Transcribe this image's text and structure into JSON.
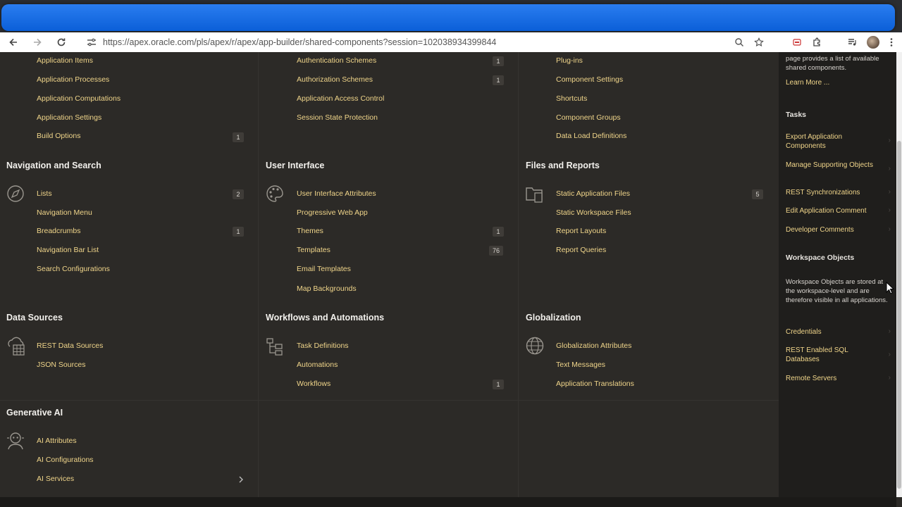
{
  "browser": {
    "url": "https://apex.oracle.com/pls/apex/r/apex/app-builder/shared-components?session=102038934399844"
  },
  "sections": {
    "app_logic": {
      "items": [
        {
          "label": "Application Items",
          "count": ""
        },
        {
          "label": "Application Processes",
          "count": ""
        },
        {
          "label": "Application Computations",
          "count": ""
        },
        {
          "label": "Application Settings",
          "count": ""
        },
        {
          "label": "Build Options",
          "count": "1"
        }
      ]
    },
    "security": {
      "items": [
        {
          "label": "Authentication Schemes",
          "count": "1"
        },
        {
          "label": "Authorization Schemes",
          "count": "1"
        },
        {
          "label": "Application Access Control",
          "count": ""
        },
        {
          "label": "Session State Protection",
          "count": ""
        }
      ]
    },
    "other_components": {
      "items": [
        {
          "label": "Plug-ins",
          "count": ""
        },
        {
          "label": "Component Settings",
          "count": ""
        },
        {
          "label": "Shortcuts",
          "count": ""
        },
        {
          "label": "Component Groups",
          "count": ""
        },
        {
          "label": "Data Load Definitions",
          "count": ""
        }
      ]
    },
    "navigation": {
      "title": "Navigation and Search",
      "icon": "compass-icon",
      "items": [
        {
          "label": "Lists",
          "count": "2"
        },
        {
          "label": "Navigation Menu",
          "count": ""
        },
        {
          "label": "Breadcrumbs",
          "count": "1"
        },
        {
          "label": "Navigation Bar List",
          "count": ""
        },
        {
          "label": "Search Configurations",
          "count": ""
        }
      ]
    },
    "user_interface": {
      "title": "User Interface",
      "icon": "palette-icon",
      "items": [
        {
          "label": "User Interface Attributes",
          "count": ""
        },
        {
          "label": "Progressive Web App",
          "count": ""
        },
        {
          "label": "Themes",
          "count": "1"
        },
        {
          "label": "Templates",
          "count": "76"
        },
        {
          "label": "Email Templates",
          "count": ""
        },
        {
          "label": "Map Backgrounds",
          "count": ""
        }
      ]
    },
    "files_reports": {
      "title": "Files and Reports",
      "icon": "folder-file-icon",
      "items": [
        {
          "label": "Static Application Files",
          "count": "5"
        },
        {
          "label": "Static Workspace Files",
          "count": ""
        },
        {
          "label": "Report Layouts",
          "count": ""
        },
        {
          "label": "Report Queries",
          "count": ""
        }
      ]
    },
    "data_sources": {
      "title": "Data Sources",
      "icon": "cloud-grid-icon",
      "items": [
        {
          "label": "REST Data Sources",
          "count": ""
        },
        {
          "label": "JSON Sources",
          "count": ""
        }
      ]
    },
    "workflows": {
      "title": "Workflows and Automations",
      "icon": "flow-tree-icon",
      "items": [
        {
          "label": "Task Definitions",
          "count": ""
        },
        {
          "label": "Automations",
          "count": ""
        },
        {
          "label": "Workflows",
          "count": "1"
        }
      ]
    },
    "globalization": {
      "title": "Globalization",
      "icon": "globe-icon",
      "items": [
        {
          "label": "Globalization Attributes",
          "count": ""
        },
        {
          "label": "Text Messages",
          "count": ""
        },
        {
          "label": "Application Translations",
          "count": ""
        }
      ]
    },
    "generative_ai": {
      "title": "Generative AI",
      "icon": "ai-agent-icon",
      "items": [
        {
          "label": "AI Attributes",
          "count": ""
        },
        {
          "label": "AI Configurations",
          "count": ""
        },
        {
          "label": "AI Services",
          "count": ""
        }
      ]
    }
  },
  "sidebar": {
    "intro_line1": "page provides a list of available",
    "intro_line2": "shared components.",
    "learn_more": "Learn More ...",
    "tasks_title": "Tasks",
    "tasks": [
      "Export Application Components",
      "Manage Supporting Objects",
      "REST Synchronizations",
      "Edit Application Comment",
      "Developer Comments"
    ],
    "workspace_title": "Workspace Objects",
    "workspace_text": "Workspace Objects are stored at the workspace-level and are therefore visible in all applications.",
    "workspace_links": [
      "Credentials",
      "REST Enabled SQL Databases",
      "Remote Servers"
    ]
  }
}
